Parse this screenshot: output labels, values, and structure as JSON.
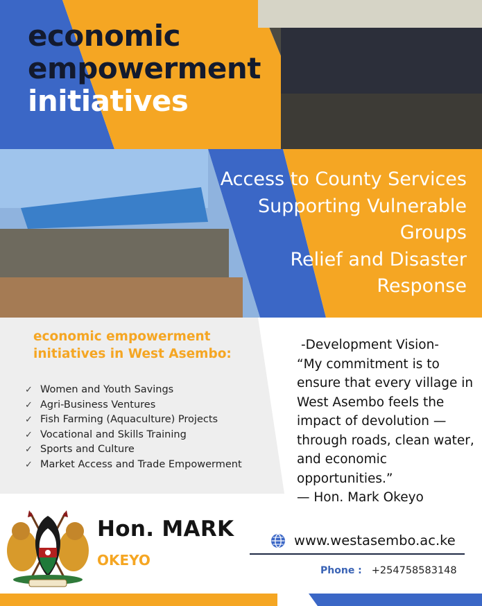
{
  "headline": {
    "line1": "economic",
    "line2": "empowerment",
    "line3": "initiatives"
  },
  "services": [
    "Access to County Services",
    "Supporting Vulnerable",
    "Groups",
    "Relief and Disaster",
    "Response"
  ],
  "list": {
    "title_line1": "economic empowerment",
    "title_line2": "initiatives in West Asembo:",
    "items": [
      "Women and Youth Savings",
      "Agri-Business Ventures",
      "Fish Farming (Aquaculture) Projects",
      "Vocational and Skills Training",
      "Sports and Culture",
      "Market Access and Trade Empowerment"
    ]
  },
  "quote": {
    "heading": "-Development Vision-",
    "text": "“My commitment is to ensure that every village in West Asembo feels the impact of devolution — through roads, clean water, and economic opportunities.”",
    "attribution": "— Hon. Mark Okeyo"
  },
  "footer": {
    "name_line1": "Hon. MARK",
    "name_line2": "OKEYO",
    "website": "www.westasembo.ac.ke",
    "phone_label": "Phone :",
    "phone_number": "+254758583148"
  },
  "colors": {
    "orange": "#f5a623",
    "blue": "#3b67c6",
    "navy": "#1f2a44",
    "light_gray": "#eeeeee"
  },
  "icons": {
    "check": "check-icon",
    "globe": "globe-icon",
    "crest": "coat-of-arms-icon"
  }
}
